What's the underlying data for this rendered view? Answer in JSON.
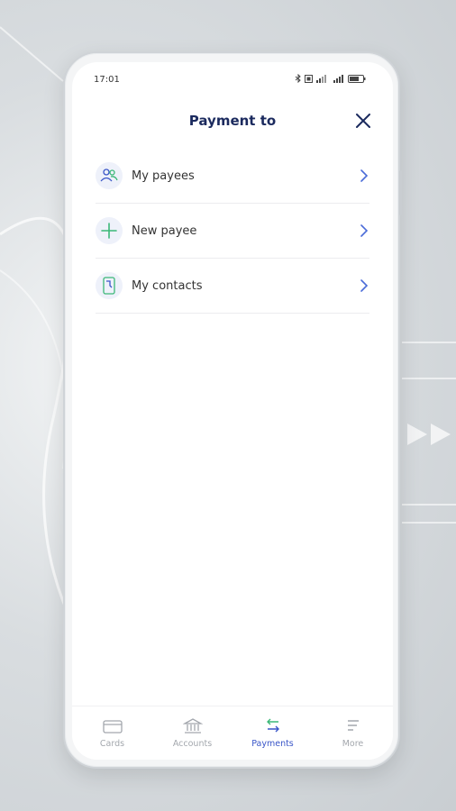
{
  "status_bar": {
    "time": "17:01",
    "icons": [
      "bluetooth-icon",
      "nfc-icon",
      "signal-icon",
      "signal-icon",
      "battery-icon"
    ]
  },
  "header": {
    "title": "Payment to",
    "close_icon": "close-icon"
  },
  "menu": [
    {
      "label": "My payees",
      "icon": "users-icon"
    },
    {
      "label": "New payee",
      "icon": "plus-icon"
    },
    {
      "label": "My contacts",
      "icon": "contacts-phone-icon"
    }
  ],
  "bottom_nav": [
    {
      "label": "Cards",
      "icon": "card-icon",
      "active": false
    },
    {
      "label": "Accounts",
      "icon": "bank-icon",
      "active": false
    },
    {
      "label": "Payments",
      "icon": "transfer-icon",
      "active": true
    },
    {
      "label": "More",
      "icon": "menu-icon",
      "active": false
    }
  ],
  "colors": {
    "title": "#1b2a5e",
    "accent": "#3a56c8",
    "icon_green": "#3cb878",
    "chevron": "#4a6bd8"
  }
}
